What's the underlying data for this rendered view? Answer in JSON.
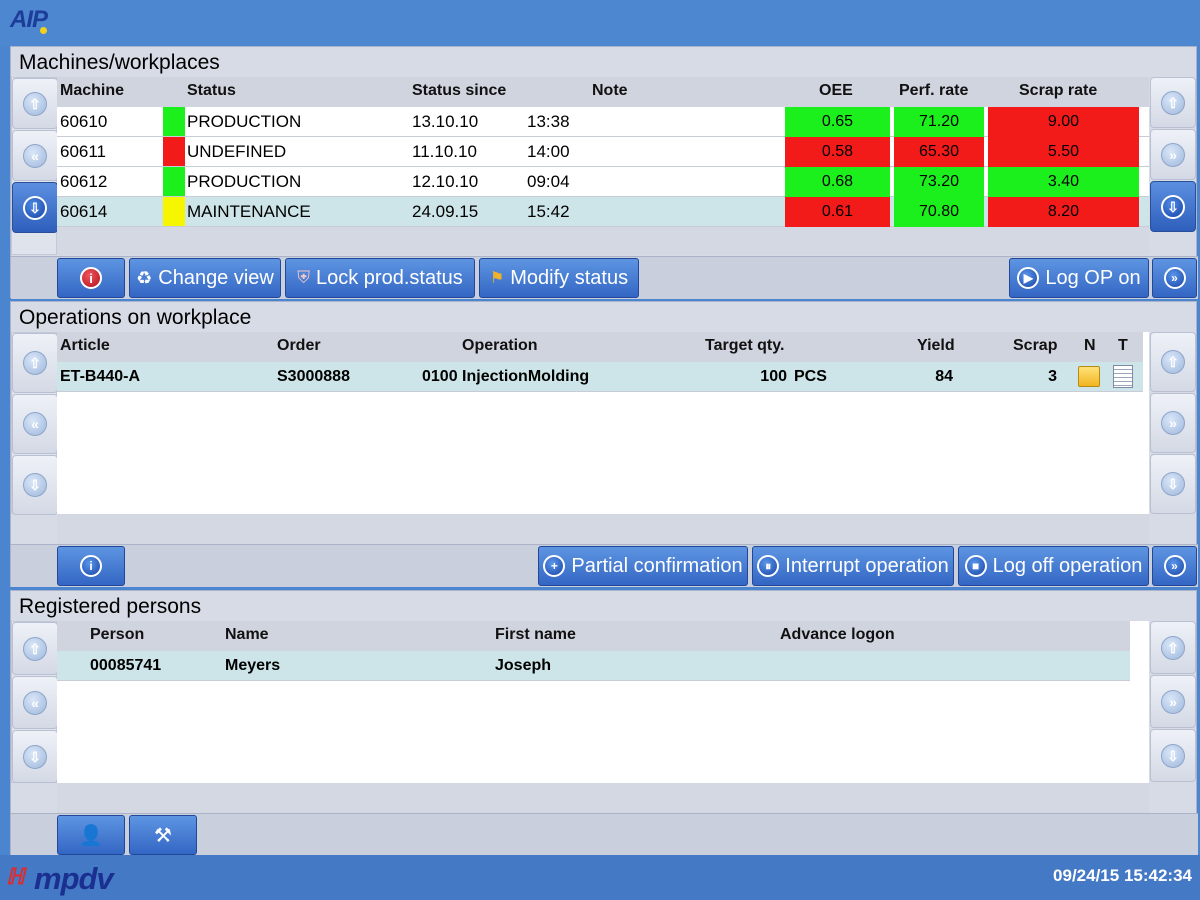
{
  "app": {
    "logo_text": "AIP",
    "footer_logo_text": "mpdv",
    "clock": "09/24/15 15:42:34"
  },
  "machines": {
    "title": "Machines/workplaces",
    "columns": {
      "machine": "Machine",
      "status": "Status",
      "status_since": "Status since",
      "note": "Note",
      "oee": "OEE",
      "perf_rate": "Perf. rate",
      "scrap_rate": "Scrap rate"
    },
    "rows": [
      {
        "machine": "60610",
        "status": "PRODUCTION",
        "status_color": "green",
        "date": "13.10.10",
        "time": "13:38",
        "note": "",
        "oee": "0.65",
        "oee_color": "green",
        "perf": "71.20",
        "perf_color": "green",
        "scrap": "9.00",
        "scrap_color": "red"
      },
      {
        "machine": "60611",
        "status": "UNDEFINED",
        "status_color": "red",
        "date": "11.10.10",
        "time": "14:00",
        "note": "",
        "oee": "0.58",
        "oee_color": "red",
        "perf": "65.30",
        "perf_color": "red",
        "scrap": "5.50",
        "scrap_color": "red"
      },
      {
        "machine": "60612",
        "status": "PRODUCTION",
        "status_color": "green",
        "date": "12.10.10",
        "time": "09:04",
        "note": "",
        "oee": "0.68",
        "oee_color": "green",
        "perf": "73.20",
        "perf_color": "green",
        "scrap": "3.40",
        "scrap_color": "green"
      },
      {
        "machine": "60614",
        "status": "MAINTENANCE",
        "status_color": "yellow",
        "date": "24.09.15",
        "time": "15:42",
        "note": "",
        "oee": "0.61",
        "oee_color": "red",
        "perf": "70.80",
        "perf_color": "green",
        "scrap": "8.20",
        "scrap_color": "red"
      }
    ],
    "buttons": {
      "change_view": "Change view",
      "lock_status": "Lock prod.status",
      "modify_status": "Modify status",
      "log_op_on": "Log OP on"
    }
  },
  "operations": {
    "title": "Operations on workplace",
    "columns": {
      "article": "Article",
      "order": "Order",
      "operation": "Operation",
      "target_qty": "Target qty.",
      "yield": "Yield",
      "scrap": "Scrap",
      "n": "N",
      "t": "T"
    },
    "rows": [
      {
        "article": "ET-B440-A",
        "order": "S3000888",
        "operation": "0100 InjectionMolding",
        "target_qty": "100",
        "unit": "PCS",
        "yield": "84",
        "scrap": "3"
      }
    ],
    "buttons": {
      "partial_confirmation": "Partial confirmation",
      "interrupt_operation": "Interrupt operation",
      "log_off_operation": "Log off operation"
    }
  },
  "persons": {
    "title": "Registered persons",
    "columns": {
      "person": "Person",
      "name": "Name",
      "first_name": "First name",
      "advance_logon": "Advance logon"
    },
    "rows": [
      {
        "person": "00085741",
        "name": "Meyers",
        "first_name": "Joseph",
        "advance_logon": ""
      }
    ]
  },
  "colors": {
    "green": "#1cf01c",
    "red": "#f31a1a",
    "yellow": "#f6f600",
    "selected_row": "#cde5e8",
    "accent_blue": "#3366c4"
  },
  "icons": {
    "nav_up": "arrow-up-icon",
    "nav_page": "double-arrow-icon",
    "nav_down": "arrow-down-icon",
    "info": "info-icon",
    "refresh": "refresh-icon",
    "shield": "shield-icon",
    "flag": "flag-icon",
    "play": "play-icon",
    "forward": "forward-icon",
    "plus": "plus-icon",
    "pause": "pause-icon",
    "stop": "stop-icon",
    "person": "person-icon",
    "tools": "tools-icon",
    "note": "note-icon",
    "text": "text-icon"
  }
}
